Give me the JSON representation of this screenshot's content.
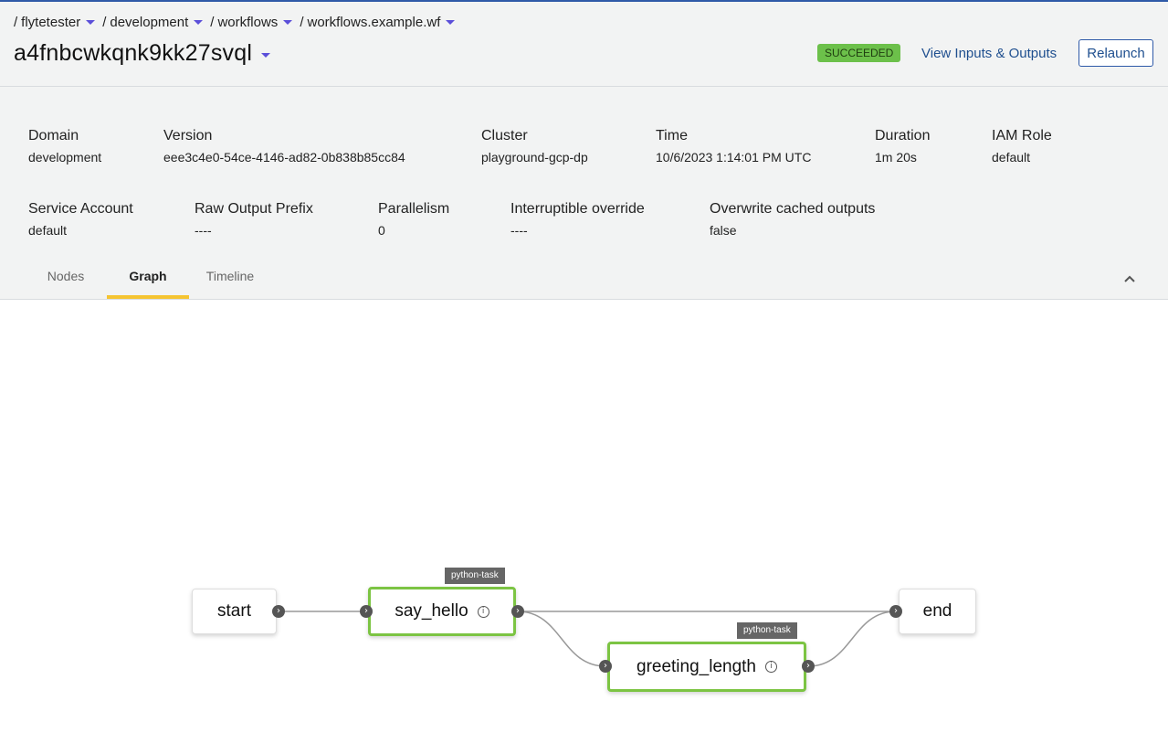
{
  "breadcrumb": [
    {
      "label": "flytetester"
    },
    {
      "label": "development"
    },
    {
      "label": "workflows"
    },
    {
      "label": "workflows.example.wf"
    }
  ],
  "breadcrumb_separator": "/",
  "execution": {
    "title": "a4fnbcwkqnk9kk27svql",
    "status": "SUCCEEDED",
    "io_link": "View Inputs & Outputs",
    "relaunch_label": "Relaunch"
  },
  "details": {
    "domain": {
      "label": "Domain",
      "value": "development"
    },
    "version": {
      "label": "Version",
      "value": "eee3c4e0-54ce-4146-ad82-0b838b85cc84"
    },
    "cluster": {
      "label": "Cluster",
      "value": "playground-gcp-dp"
    },
    "time": {
      "label": "Time",
      "value": "10/6/2023 1:14:01 PM UTC"
    },
    "duration": {
      "label": "Duration",
      "value": "1m 20s"
    },
    "iam_role": {
      "label": "IAM Role",
      "value": "default"
    },
    "service_account": {
      "label": "Service Account",
      "value": "default"
    },
    "raw_output_prefix": {
      "label": "Raw Output Prefix",
      "value": "----"
    },
    "parallelism": {
      "label": "Parallelism",
      "value": "0"
    },
    "interruptible_override": {
      "label": "Interruptible override",
      "value": "----"
    },
    "overwrite_cached_outputs": {
      "label": "Overwrite cached outputs",
      "value": "false"
    }
  },
  "tabs": [
    {
      "label": "Nodes"
    },
    {
      "label": "Graph"
    },
    {
      "label": "Timeline"
    }
  ],
  "active_tab": "Graph",
  "graph": {
    "nodes": {
      "start": {
        "label": "start"
      },
      "say_hello": {
        "label": "say_hello",
        "tag": "python-task"
      },
      "greeting_length": {
        "label": "greeting_length",
        "tag": "python-task"
      },
      "end": {
        "label": "end"
      }
    }
  },
  "colors": {
    "accent": "#2f5aa8",
    "success": "#6cc04a",
    "task_border": "#7cc443",
    "tab_underline": "#f5c431",
    "caret": "#5b4fd9"
  }
}
